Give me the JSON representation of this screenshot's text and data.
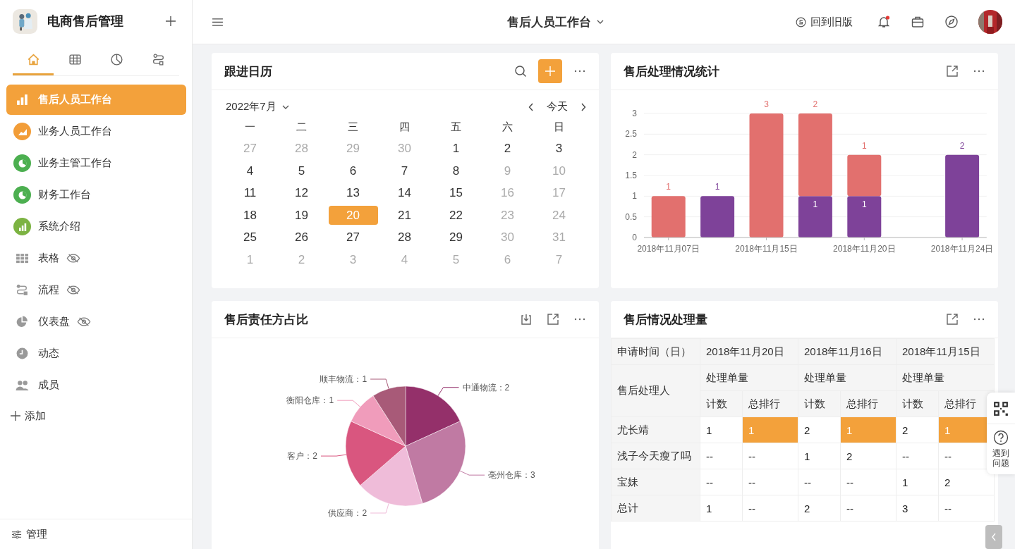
{
  "app": {
    "name": "电商售后管理"
  },
  "sidebar_tabs": [
    {
      "kind": "home",
      "selected": true
    },
    {
      "kind": "grid",
      "selected": false
    },
    {
      "kind": "pie",
      "selected": false
    },
    {
      "kind": "flow",
      "selected": false
    }
  ],
  "sidebar": {
    "items": [
      {
        "label": "售后人员工作台",
        "kind": "bars",
        "selected": true,
        "hidden": false
      },
      {
        "label": "业务人员工作台",
        "kind": "area",
        "color": "#f29d38",
        "selected": false,
        "hidden": false
      },
      {
        "label": "业务主管工作台",
        "kind": "pie",
        "color": "#4caf50",
        "selected": false,
        "hidden": false
      },
      {
        "label": "财务工作台",
        "kind": "pie",
        "color": "#4caf50",
        "selected": false,
        "hidden": false
      },
      {
        "label": "系统介绍",
        "kind": "bars",
        "color": "#7cb342",
        "selected": false,
        "hidden": false
      },
      {
        "label": "表格",
        "kind": "grid",
        "selected": false,
        "hidden": true
      },
      {
        "label": "流程",
        "kind": "flow",
        "selected": false,
        "hidden": true
      },
      {
        "label": "仪表盘",
        "kind": "pie",
        "selected": false,
        "hidden": true
      },
      {
        "label": "动态",
        "kind": "clock",
        "selected": false,
        "hidden": false
      },
      {
        "label": "成员",
        "kind": "people",
        "selected": false,
        "hidden": false
      }
    ],
    "add": "添加",
    "manage": "管理"
  },
  "header": {
    "title": "售后人员工作台",
    "old_version": "回到旧版",
    "notification": true
  },
  "calendar": {
    "title": "跟进日历",
    "month": "2022年7月",
    "today": "今天",
    "weekdays": [
      "一",
      "二",
      "三",
      "四",
      "五",
      "六",
      "日"
    ],
    "weeks": [
      [
        {
          "label": "27",
          "muted": true,
          "selected": false
        },
        {
          "label": "28",
          "muted": true,
          "selected": false
        },
        {
          "label": "29",
          "muted": true,
          "selected": false
        },
        {
          "label": "30",
          "muted": true,
          "selected": false
        },
        {
          "label": "1",
          "muted": false,
          "selected": false
        },
        {
          "label": "2",
          "muted": false,
          "selected": false
        },
        {
          "label": "3",
          "muted": false,
          "selected": false
        }
      ],
      [
        {
          "label": "4",
          "muted": false,
          "selected": false
        },
        {
          "label": "5",
          "muted": false,
          "selected": false
        },
        {
          "label": "6",
          "muted": false,
          "selected": false
        },
        {
          "label": "7",
          "muted": false,
          "selected": false
        },
        {
          "label": "8",
          "muted": false,
          "selected": false
        },
        {
          "label": "9",
          "muted": true,
          "selected": false
        },
        {
          "label": "10",
          "muted": true,
          "selected": false
        }
      ],
      [
        {
          "label": "11",
          "muted": false,
          "selected": false
        },
        {
          "label": "12",
          "muted": false,
          "selected": false
        },
        {
          "label": "13",
          "muted": false,
          "selected": false
        },
        {
          "label": "14",
          "muted": false,
          "selected": false
        },
        {
          "label": "15",
          "muted": false,
          "selected": false
        },
        {
          "label": "16",
          "muted": true,
          "selected": false
        },
        {
          "label": "17",
          "muted": true,
          "selected": false
        }
      ],
      [
        {
          "label": "18",
          "muted": false,
          "selected": false
        },
        {
          "label": "19",
          "muted": false,
          "selected": false
        },
        {
          "label": "20",
          "muted": false,
          "selected": true
        },
        {
          "label": "21",
          "muted": false,
          "selected": false
        },
        {
          "label": "22",
          "muted": false,
          "selected": false
        },
        {
          "label": "23",
          "muted": true,
          "selected": false
        },
        {
          "label": "24",
          "muted": true,
          "selected": false
        }
      ],
      [
        {
          "label": "25",
          "muted": false,
          "selected": false
        },
        {
          "label": "26",
          "muted": false,
          "selected": false
        },
        {
          "label": "27",
          "muted": false,
          "selected": false
        },
        {
          "label": "28",
          "muted": false,
          "selected": false
        },
        {
          "label": "29",
          "muted": false,
          "selected": false
        },
        {
          "label": "30",
          "muted": true,
          "selected": false
        },
        {
          "label": "31",
          "muted": true,
          "selected": false
        }
      ],
      [
        {
          "label": "1",
          "muted": true,
          "selected": false
        },
        {
          "label": "2",
          "muted": true,
          "selected": false
        },
        {
          "label": "3",
          "muted": true,
          "selected": false
        },
        {
          "label": "4",
          "muted": true,
          "selected": false
        },
        {
          "label": "5",
          "muted": true,
          "selected": false
        },
        {
          "label": "6",
          "muted": true,
          "selected": false
        },
        {
          "label": "7",
          "muted": true,
          "selected": false
        }
      ]
    ]
  },
  "stats": {
    "title": "售后处理情况统计",
    "chart_data": {
      "type": "bar",
      "stacked": true,
      "data_labels": true,
      "grid": true,
      "categories": [
        "2018年11月07日",
        null,
        "2018年11月15日",
        null,
        "2018年11月20日",
        null,
        "2018年11月24日"
      ],
      "yticks": [
        0,
        0.5,
        1,
        1.5,
        2,
        2.5,
        3
      ],
      "ylim": [
        0,
        3
      ],
      "series": [
        {
          "color": "#7e4299",
          "values": [
            null,
            1,
            null,
            1,
            1,
            null,
            2
          ]
        },
        {
          "color": "#e2706e",
          "values": [
            1,
            null,
            3,
            2,
            1,
            null,
            null
          ]
        }
      ]
    }
  },
  "pie": {
    "title": "售后责任方占比",
    "chart_data": {
      "type": "pie",
      "categories": [
        "中通物流",
        "亳州仓库",
        "供应商",
        "客户",
        "衡阳仓库",
        "顺丰物流"
      ],
      "values": [
        2,
        3,
        2,
        2,
        1,
        1
      ],
      "colors": [
        "#94306a",
        "#c07aa3",
        "#efbcd9",
        "#d9567f",
        "#f09cbb",
        "#a85a78"
      ],
      "value_labels": [
        "：2",
        "：3",
        "：2",
        "：2",
        "：1",
        "：1"
      ]
    }
  },
  "volume": {
    "title": "售后情况处理量",
    "corner_top": "申请时间（日）",
    "corner_bottom": "售后处理人",
    "dates": [
      {
        "label": "2018年11月20日",
        "group": "处理单量",
        "subs": [
          "计数",
          "总排行"
        ]
      },
      {
        "label": "2018年11月16日",
        "group": "处理单量",
        "subs": [
          "计数",
          "总排行"
        ]
      },
      {
        "label": "2018年11月15日",
        "group": "处理单量",
        "subs": [
          "计数",
          "总排行"
        ]
      }
    ],
    "rows": [
      {
        "name": "尤长靖",
        "cells": [
          {
            "text": "1",
            "highlighted": false
          },
          {
            "text": "1",
            "highlighted": true
          },
          {
            "text": "2",
            "highlighted": false
          },
          {
            "text": "1",
            "highlighted": true
          },
          {
            "text": "2",
            "highlighted": false
          },
          {
            "text": "1",
            "highlighted": true
          }
        ]
      },
      {
        "name": "浅子今天瘦了吗",
        "cells": [
          {
            "text": "--",
            "highlighted": false
          },
          {
            "text": "--",
            "highlighted": false
          },
          {
            "text": "1",
            "highlighted": false
          },
          {
            "text": "2",
            "highlighted": false
          },
          {
            "text": "--",
            "highlighted": false
          },
          {
            "text": "--",
            "highlighted": false
          }
        ]
      },
      {
        "name": "宝妹",
        "cells": [
          {
            "text": "--",
            "highlighted": false
          },
          {
            "text": "--",
            "highlighted": false
          },
          {
            "text": "--",
            "highlighted": false
          },
          {
            "text": "--",
            "highlighted": false
          },
          {
            "text": "1",
            "highlighted": false
          },
          {
            "text": "2",
            "highlighted": false
          }
        ]
      },
      {
        "name": "总计",
        "cells": [
          {
            "text": "1",
            "highlighted": false
          },
          {
            "text": "--",
            "highlighted": false
          },
          {
            "text": "2",
            "highlighted": false
          },
          {
            "text": "--",
            "highlighted": false
          },
          {
            "text": "3",
            "highlighted": false
          },
          {
            "text": "--",
            "highlighted": false
          }
        ]
      }
    ]
  },
  "help_widget": {
    "label": "遇到问题"
  }
}
